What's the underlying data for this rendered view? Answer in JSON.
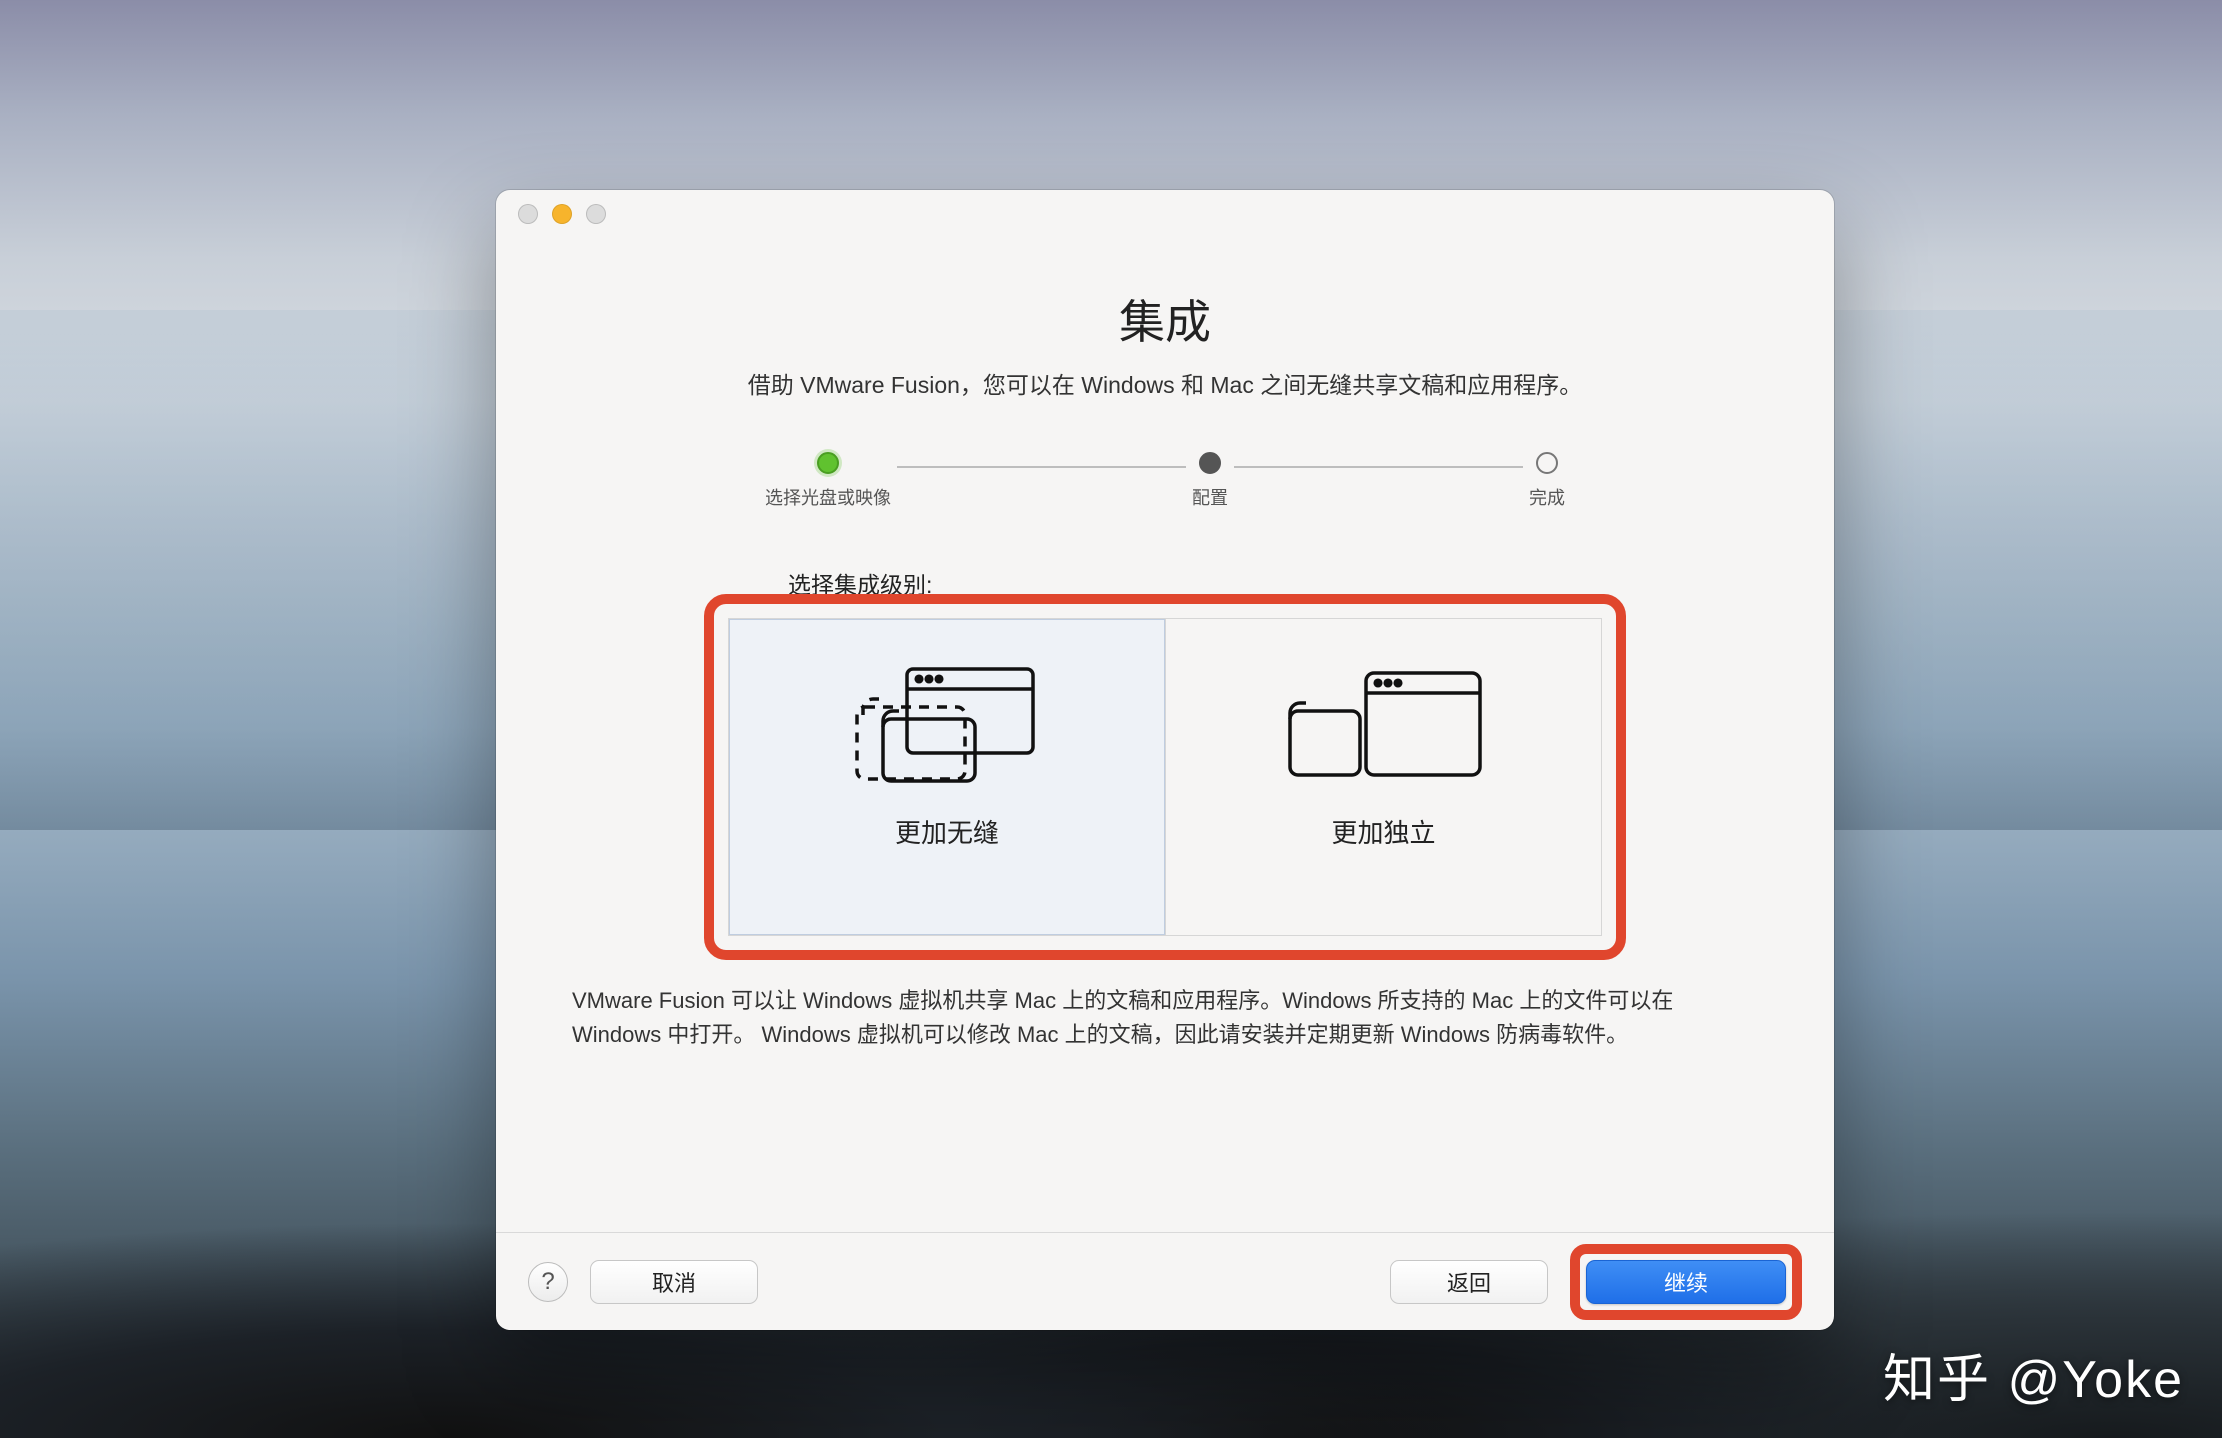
{
  "header": {
    "title": "集成",
    "subtitle": "借助 VMware Fusion，您可以在 Windows 和 Mac 之间无缝共享文稿和应用程序。"
  },
  "stepper": {
    "steps": [
      {
        "label": "选择光盘或映像",
        "state": "done"
      },
      {
        "label": "配置",
        "state": "current"
      },
      {
        "label": "完成",
        "state": "pending"
      }
    ]
  },
  "section_label": "选择集成级别:",
  "choices": {
    "seamless": "更加无缝",
    "isolated": "更加独立"
  },
  "description": "VMware Fusion 可以让 Windows 虚拟机共享 Mac 上的文稿和应用程序。Windows 所支持的 Mac 上的文件可以在 Windows 中打开。 Windows 虚拟机可以修改 Mac 上的文稿，因此请安装并定期更新 Windows 防病毒软件。",
  "buttons": {
    "help": "?",
    "cancel": "取消",
    "back": "返回",
    "continue": "继续"
  },
  "watermark_credit": "知乎 @Yoke",
  "colors": {
    "highlight": "#e0462d",
    "primary": "#1f6fe8"
  }
}
